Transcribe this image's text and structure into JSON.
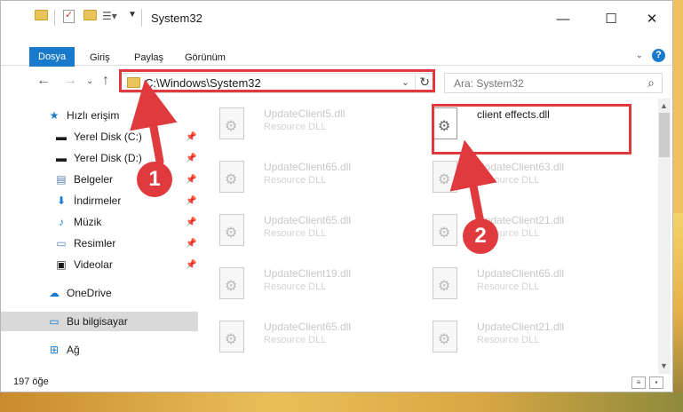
{
  "window": {
    "title": "System32"
  },
  "ribbon": {
    "tabs": [
      "Dosya",
      "Giriş",
      "Paylaş",
      "Görünüm"
    ]
  },
  "address": {
    "path": "C:\\Windows\\System32"
  },
  "search": {
    "placeholder": "Ara: System32"
  },
  "sidebar": {
    "items": [
      {
        "label": "Hızlı erişim"
      },
      {
        "label": "Yerel Disk (C:)"
      },
      {
        "label": "Yerel Disk (D:)"
      },
      {
        "label": "Belgeler"
      },
      {
        "label": "İndirmeler"
      },
      {
        "label": "Müzik"
      },
      {
        "label": "Resimler"
      },
      {
        "label": "Videolar"
      },
      {
        "label": "OneDrive"
      },
      {
        "label": "Bu bilgisayar"
      },
      {
        "label": "Ağ"
      }
    ]
  },
  "files": {
    "left": [
      {
        "name": "UpdateClient5.dll",
        "desc": "Resource DLL"
      },
      {
        "name": "UpdateClient65.dll",
        "desc": "Resource DLL"
      },
      {
        "name": "UpdateClient65.dll",
        "desc": "Resource DLL"
      },
      {
        "name": "UpdateClient19.dll",
        "desc": "Resource DLL"
      },
      {
        "name": "UpdateClient65.dll",
        "desc": "Resource DLL"
      }
    ],
    "right": [
      {
        "name": "client effects.dll",
        "desc": ""
      },
      {
        "name": "UpdateClient63.dll",
        "desc": "Resource DLL"
      },
      {
        "name": "UpdateClient21.dll",
        "desc": "Resource DLL"
      },
      {
        "name": "UpdateClient65.dll",
        "desc": "Resource DLL"
      },
      {
        "name": "UpdateClient21.dll",
        "desc": "Resource DLL"
      }
    ]
  },
  "status": {
    "count": "197 öğe"
  },
  "annotations": {
    "badge1": "1",
    "badge2": "2"
  },
  "colors": {
    "accent": "#1979ca",
    "annotation": "#e0393e"
  }
}
